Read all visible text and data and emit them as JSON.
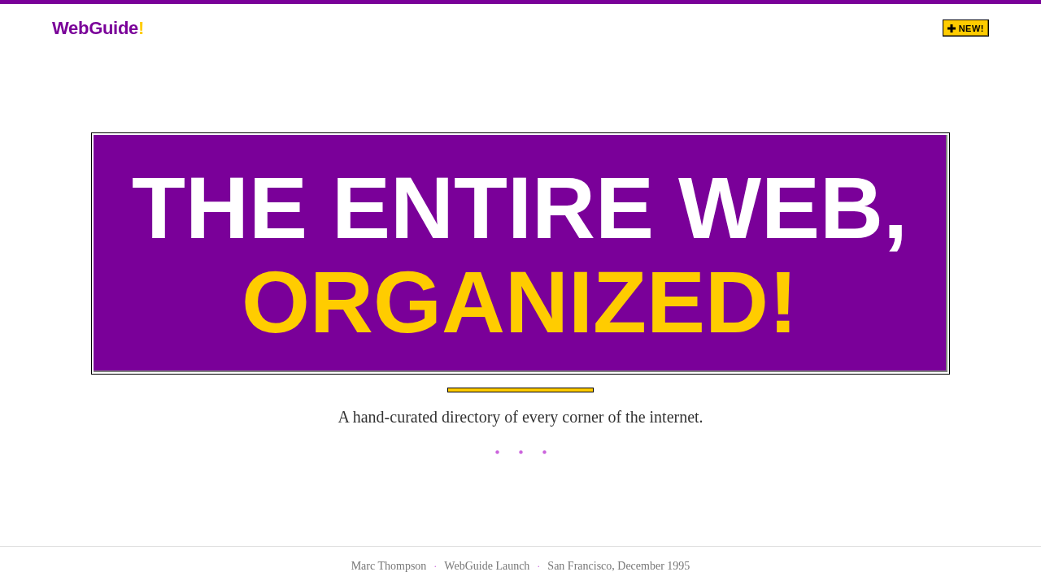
{
  "header": {
    "logo": {
      "name": "WebGuide",
      "accent": "!"
    },
    "badge": {
      "label": "NEW!"
    }
  },
  "hero": {
    "line_1": "THE ENTIRE WEB,",
    "line_2": "ORGANIZED!"
  },
  "tagline": "A hand-curated directory of every corner of the internet.",
  "footer": {
    "items": [
      "Marc Thompson",
      "WebGuide Launch",
      "San Francisco, December 1995"
    ],
    "separator": "·"
  }
}
